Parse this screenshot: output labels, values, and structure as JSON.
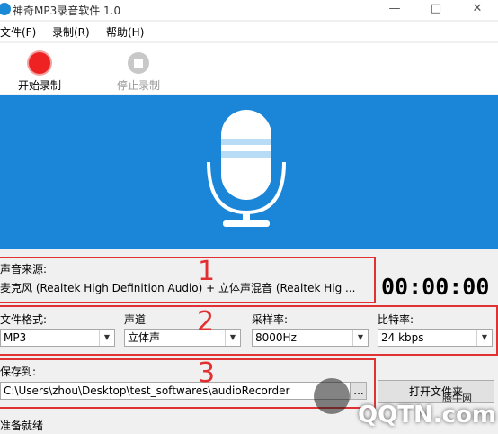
{
  "window": {
    "title": "神奇MP3录音软件 1.0",
    "min": "—",
    "max": "□",
    "close": "✕"
  },
  "menu": [
    "文件(F)",
    "录制(R)",
    "帮助(H)"
  ],
  "toolbar": {
    "start": "开始录制",
    "stop": "停止录制"
  },
  "source": {
    "label": "声音来源:",
    "value": "麦克风 (Realtek High Definition Audio) + 立体声混音 (Realtek Hig ...",
    "timer": "00:00:00"
  },
  "format": {
    "format_label": "文件格式:",
    "format_value": "MP3",
    "channel_label": "声道",
    "channel_value": "立体声",
    "rate_label": "采样率:",
    "rate_value": "8000Hz",
    "bitrate_label": "比特率:",
    "bitrate_value": "24 kbps"
  },
  "save": {
    "label": "保存到:",
    "path": "C:\\Users\\zhou\\Desktop\\test_softwares\\audioRecorder",
    "browse": "...",
    "open_folder": "打开文件夹"
  },
  "status": "准备就绪",
  "annotations": [
    "1",
    "2",
    "3"
  ],
  "watermark": {
    "site": "腾牛网",
    "brand": "QQTN.com"
  },
  "colors": {
    "banner": "#1b86d8",
    "record": "#e22222",
    "annotation": "#e03232"
  }
}
